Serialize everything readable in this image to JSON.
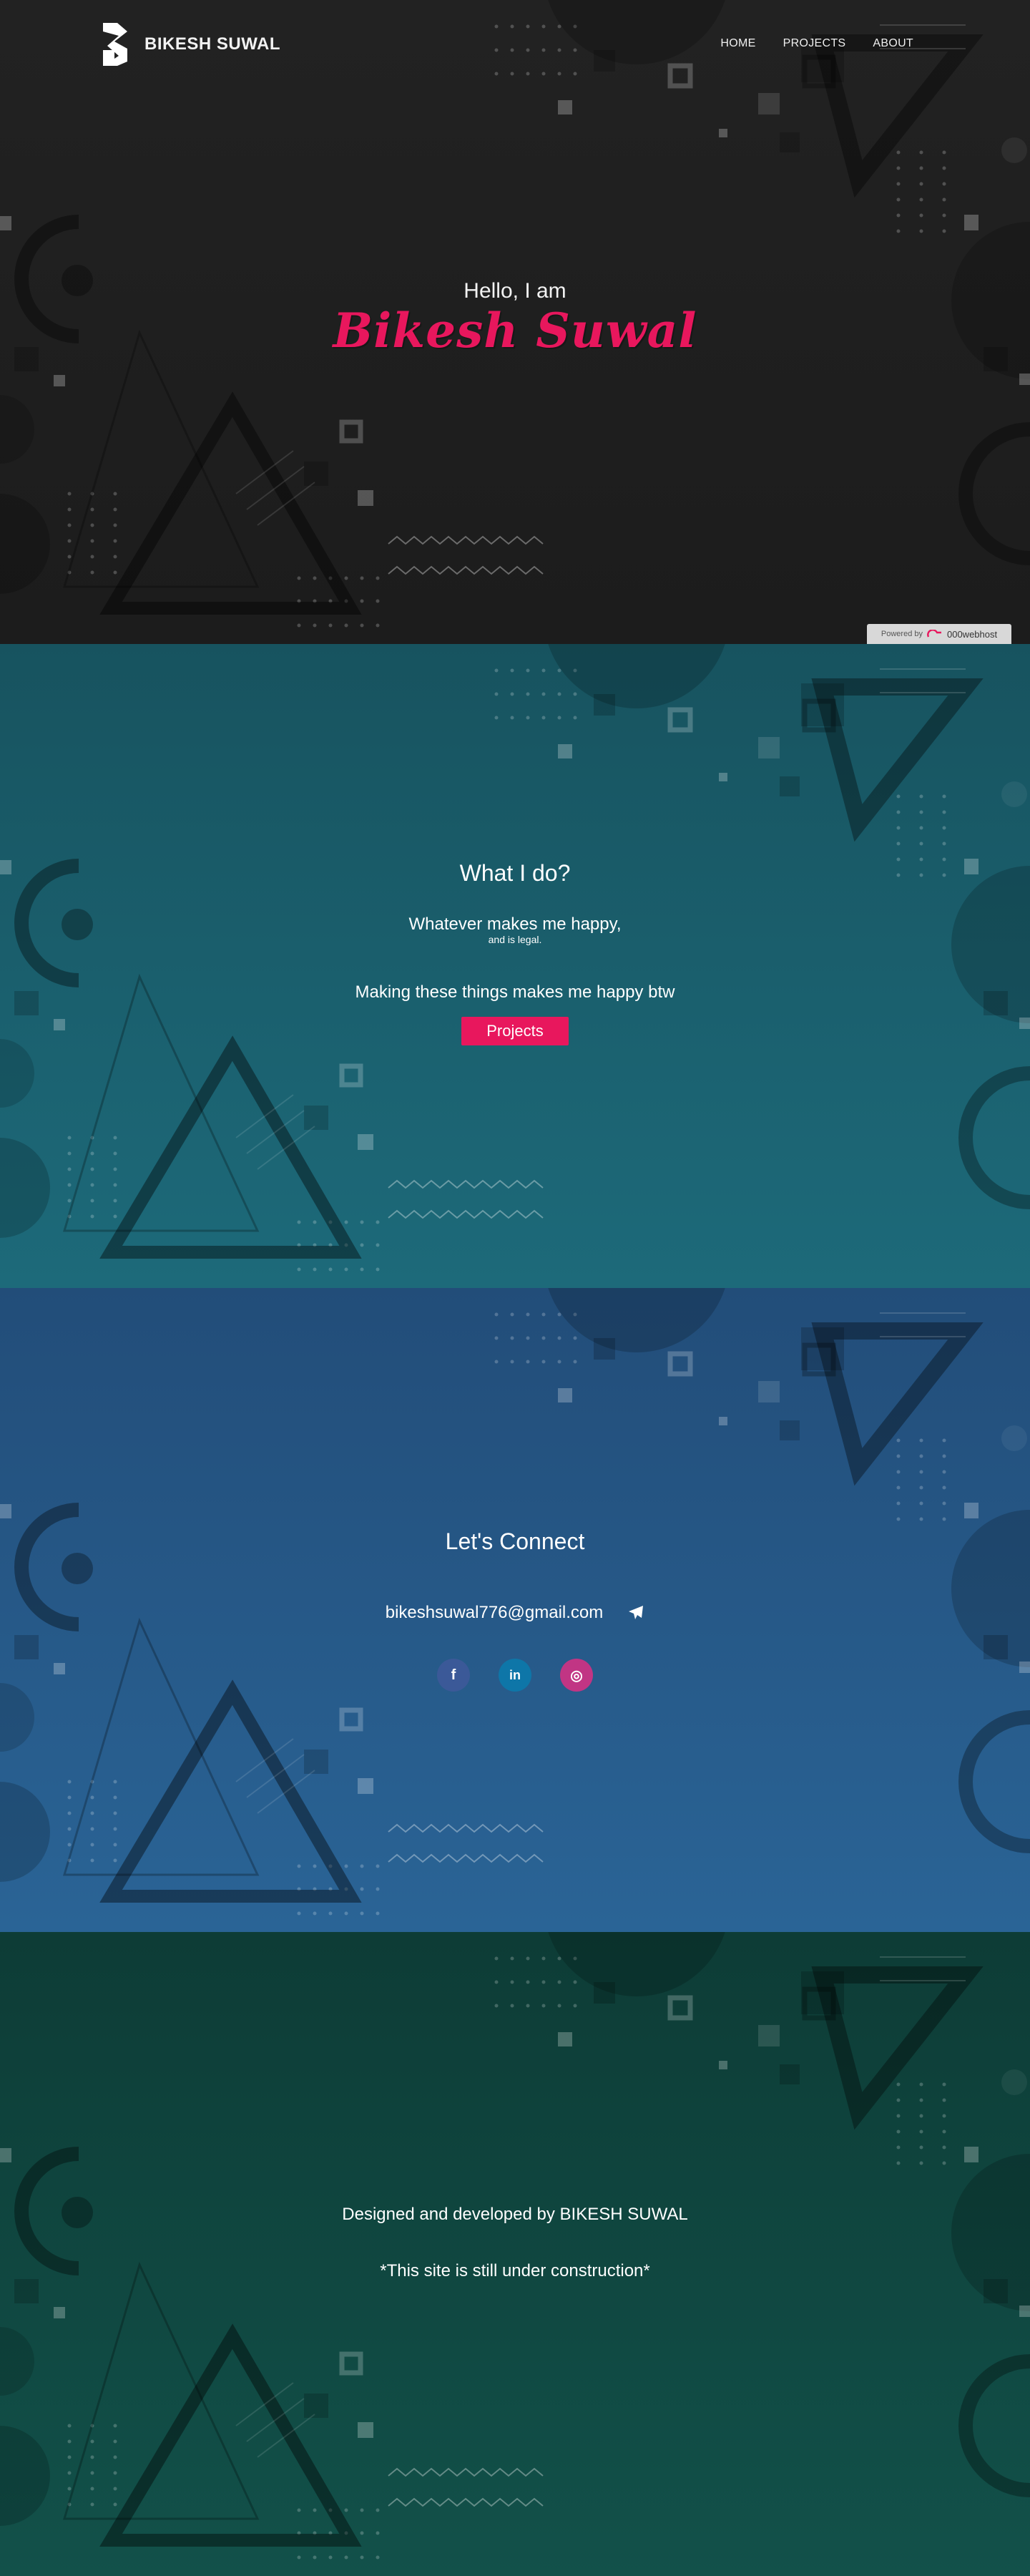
{
  "header": {
    "brand_name": "BIKESH SUWAL",
    "nav": [
      {
        "label": "HOME"
      },
      {
        "label": "PROJECTS"
      },
      {
        "label": "ABOUT"
      }
    ]
  },
  "hero": {
    "greeting": "Hello, I am",
    "name": "Bikesh Suwal",
    "name_color": "#e8175d"
  },
  "powered_badge": {
    "prefix": "Powered by",
    "brand": "000webhost"
  },
  "what_i_do": {
    "title": "What I do?",
    "line1": "Whatever makes me happy,",
    "line1_sub": "and is legal.",
    "line2": "Making these things makes me happy btw",
    "button_label": "Projects",
    "button_color": "#e8175d"
  },
  "connect": {
    "title": "Let's Connect",
    "email": "bikeshsuwal776@gmail.com",
    "send_icon": "paper-plane-icon",
    "socials": [
      {
        "name": "facebook-icon",
        "glyph": "f",
        "color": "#3b5998"
      },
      {
        "name": "linkedin-icon",
        "glyph": "in",
        "color": "#0e76a8"
      },
      {
        "name": "instagram-icon",
        "glyph": "◎",
        "color": "#c13584"
      }
    ]
  },
  "footer": {
    "credit": "Designed and developed by BIKESH SUWAL",
    "notice": "*This site is still under construction*"
  },
  "colors": {
    "hero_bg": "#1f1f1f",
    "what_bg": "#1a5f6d",
    "connect_bg": "#265a88",
    "footer_bg": "#0f4640",
    "accent": "#e8175d"
  }
}
